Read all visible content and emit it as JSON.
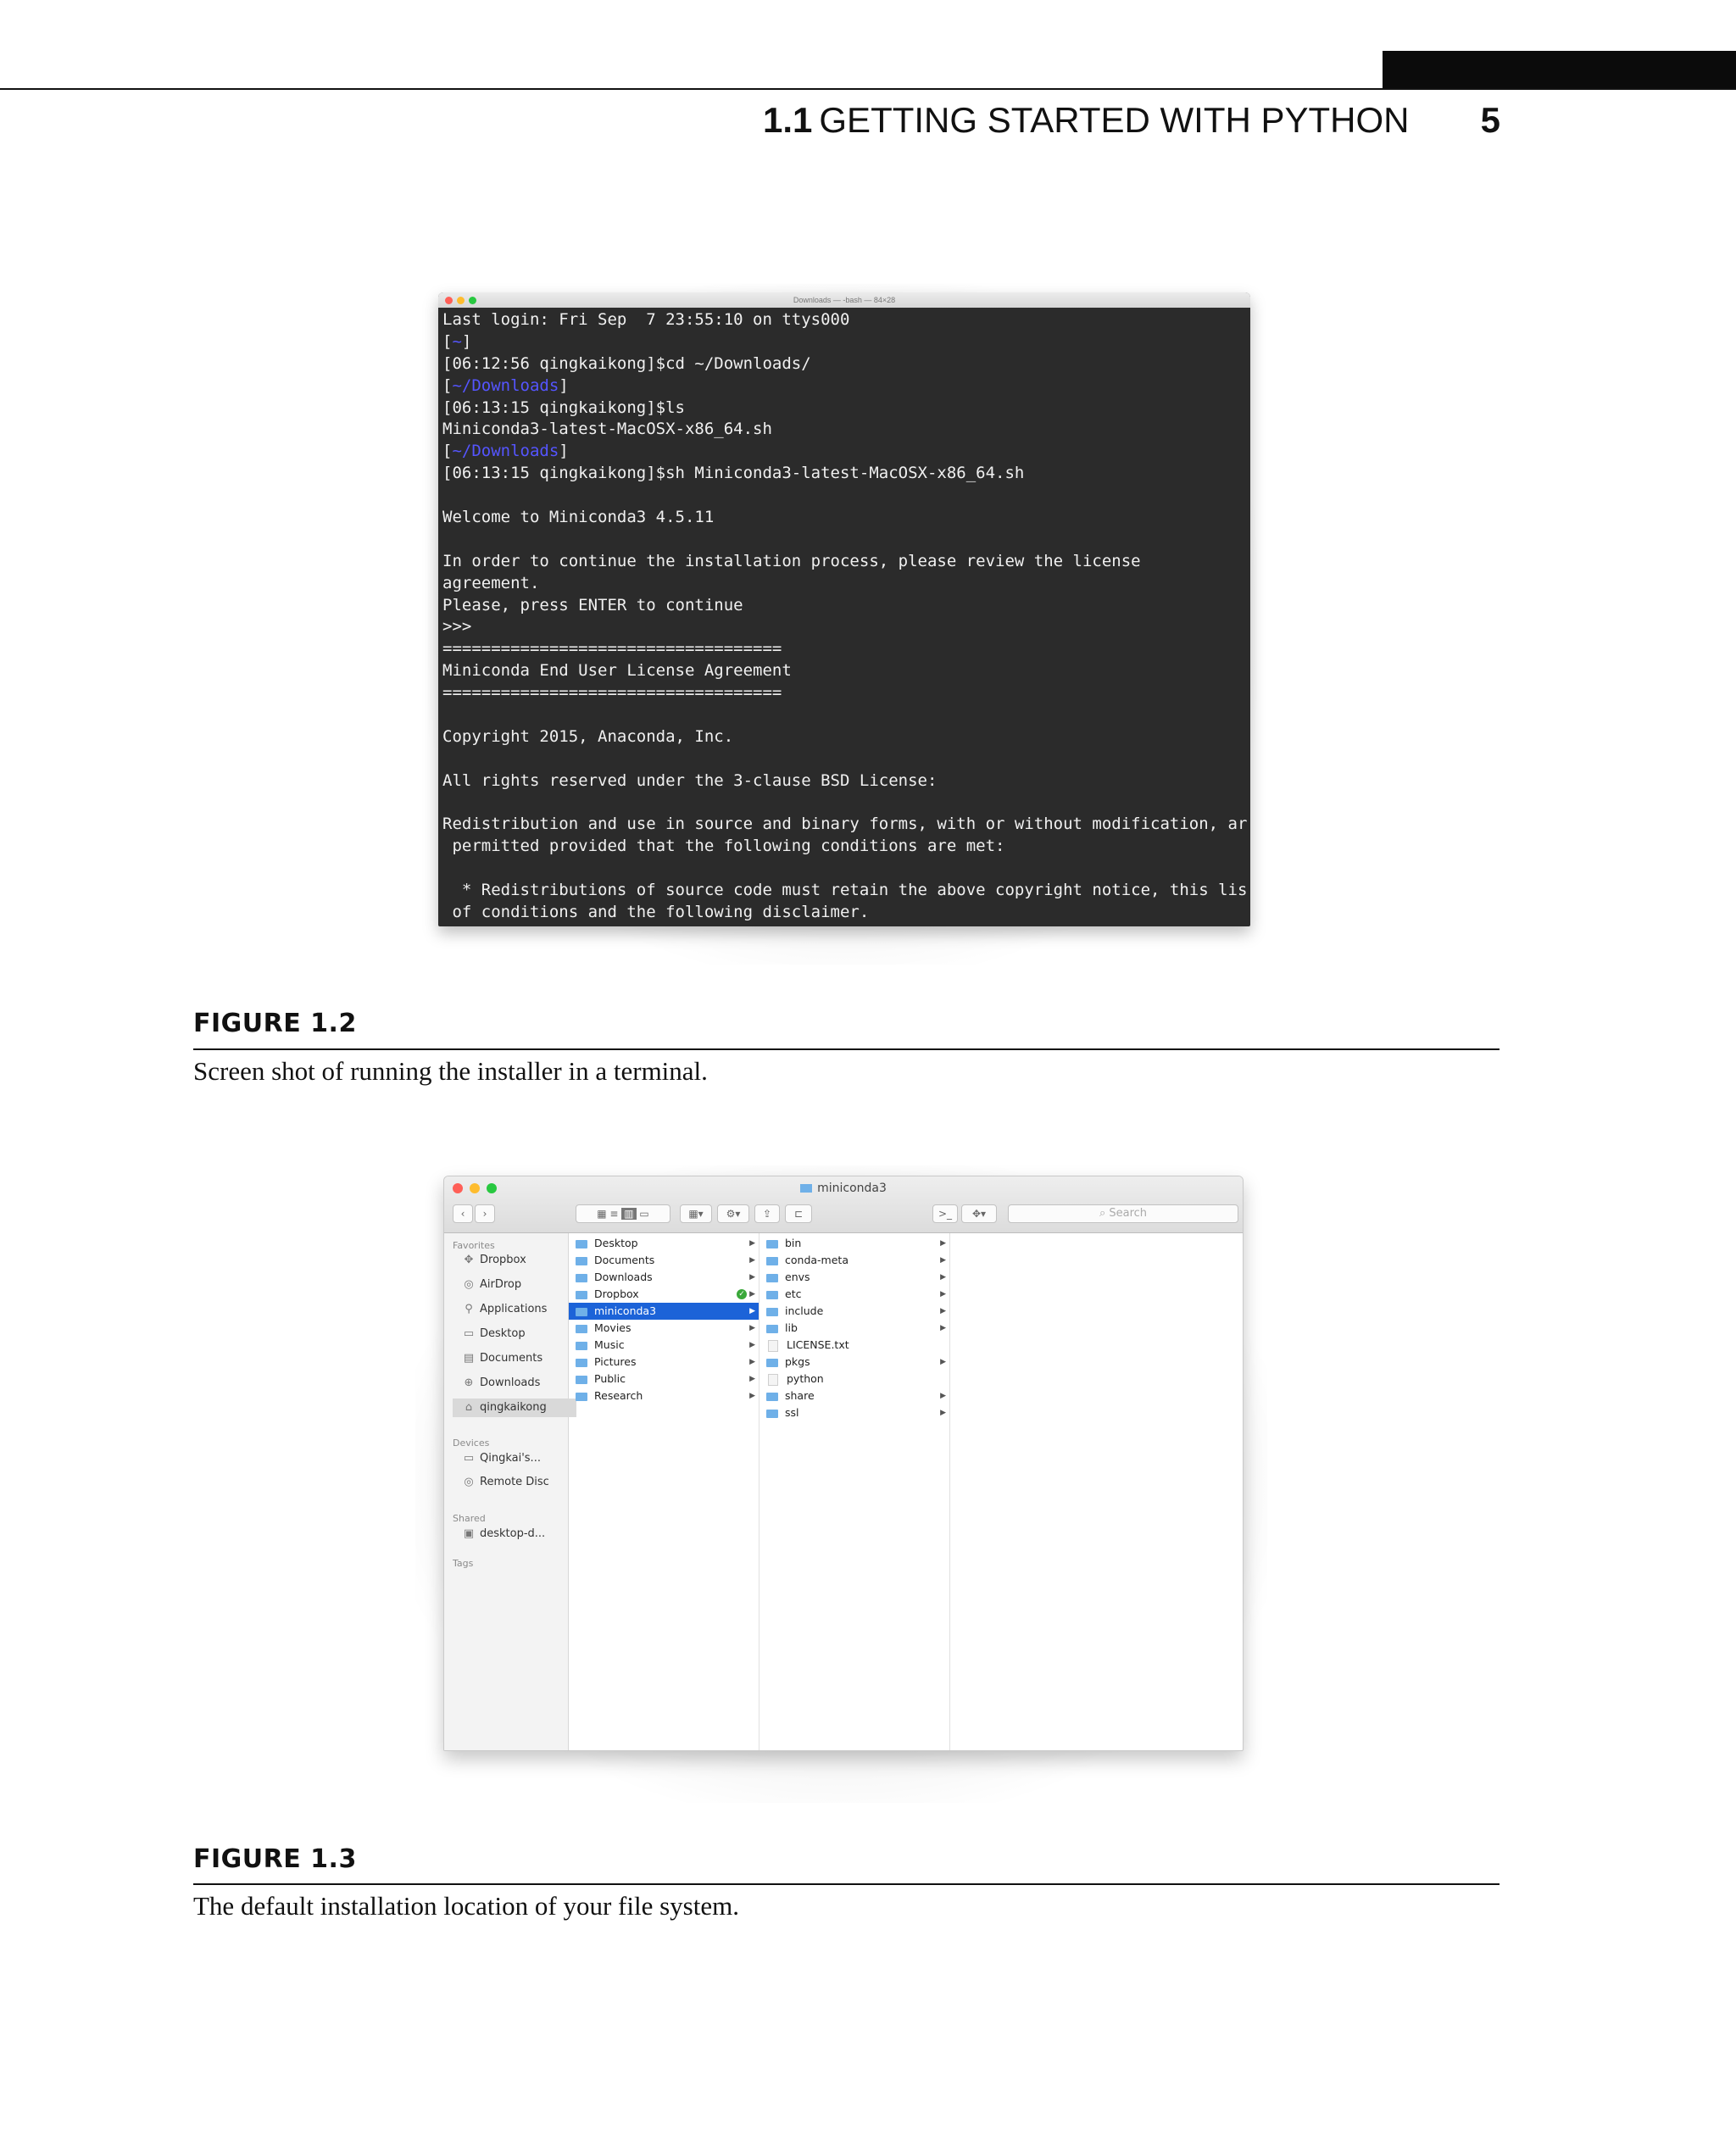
{
  "header": {
    "section_number": "1.1",
    "section_title": "GETTING STARTED WITH PYTHON",
    "page_number": "5"
  },
  "figure_1_2": {
    "label": "FIGURE 1.2",
    "caption": "Screen shot of running the installer in a terminal.",
    "terminal": {
      "window_title": "Downloads — -bash — 84×28",
      "lines": [
        {
          "text": "Last login: Fri Sep  7 23:55:10 on ttys000"
        },
        {
          "pre": "[",
          "dir": "~",
          "post": "]"
        },
        {
          "text": "[06:12:56 qingkaikong]$cd ~/Downloads/"
        },
        {
          "pre": "[",
          "dir": "~/Downloads",
          "post": "]"
        },
        {
          "text": "[06:13:15 qingkaikong]$ls"
        },
        {
          "text": "Miniconda3-latest-MacOSX-x86_64.sh"
        },
        {
          "pre": "[",
          "dir": "~/Downloads",
          "post": "]"
        },
        {
          "text": "[06:13:15 qingkaikong]$sh Miniconda3-latest-MacOSX-x86_64.sh"
        },
        {
          "text": ""
        },
        {
          "text": "Welcome to Miniconda3 4.5.11"
        },
        {
          "text": ""
        },
        {
          "text": "In order to continue the installation process, please review the license"
        },
        {
          "text": "agreement."
        },
        {
          "text": "Please, press ENTER to continue"
        },
        {
          "text": ">>>"
        },
        {
          "text": "==================================="
        },
        {
          "text": "Miniconda End User License Agreement"
        },
        {
          "text": "==================================="
        },
        {
          "text": ""
        },
        {
          "text": "Copyright 2015, Anaconda, Inc."
        },
        {
          "text": ""
        },
        {
          "text": "All rights reserved under the 3-clause BSD License:"
        },
        {
          "text": ""
        },
        {
          "text": "Redistribution and use in source and binary forms, with or without modification, are"
        },
        {
          "text": " permitted provided that the following conditions are met:"
        },
        {
          "text": ""
        },
        {
          "text": "  * Redistributions of source code must retain the above copyright notice, this list"
        },
        {
          "text": " of conditions and the following disclaimer."
        }
      ]
    }
  },
  "figure_1_3": {
    "label": "FIGURE 1.3",
    "caption": "The default installation location of your file system.",
    "finder": {
      "window_title": "miniconda3",
      "search_placeholder": "Search",
      "sidebar": {
        "favorites_heading": "Favorites",
        "favorites": [
          "Dropbox",
          "AirDrop",
          "Applications",
          "Desktop",
          "Documents",
          "Downloads",
          "qingkaikong"
        ],
        "devices_heading": "Devices",
        "devices": [
          "Qingkai's...",
          "Remote Disc"
        ],
        "shared_heading": "Shared",
        "shared": [
          "desktop-d..."
        ],
        "tags_heading": "Tags"
      },
      "home_items": [
        "Desktop",
        "Documents",
        "Downloads",
        "Dropbox",
        "miniconda3",
        "Movies",
        "Music",
        "Pictures",
        "Public",
        "Research"
      ],
      "miniconda_items": [
        "bin",
        "conda-meta",
        "envs",
        "etc",
        "include",
        "lib",
        "LICENSE.txt",
        "pkgs",
        "python",
        "share",
        "ssl"
      ]
    }
  }
}
